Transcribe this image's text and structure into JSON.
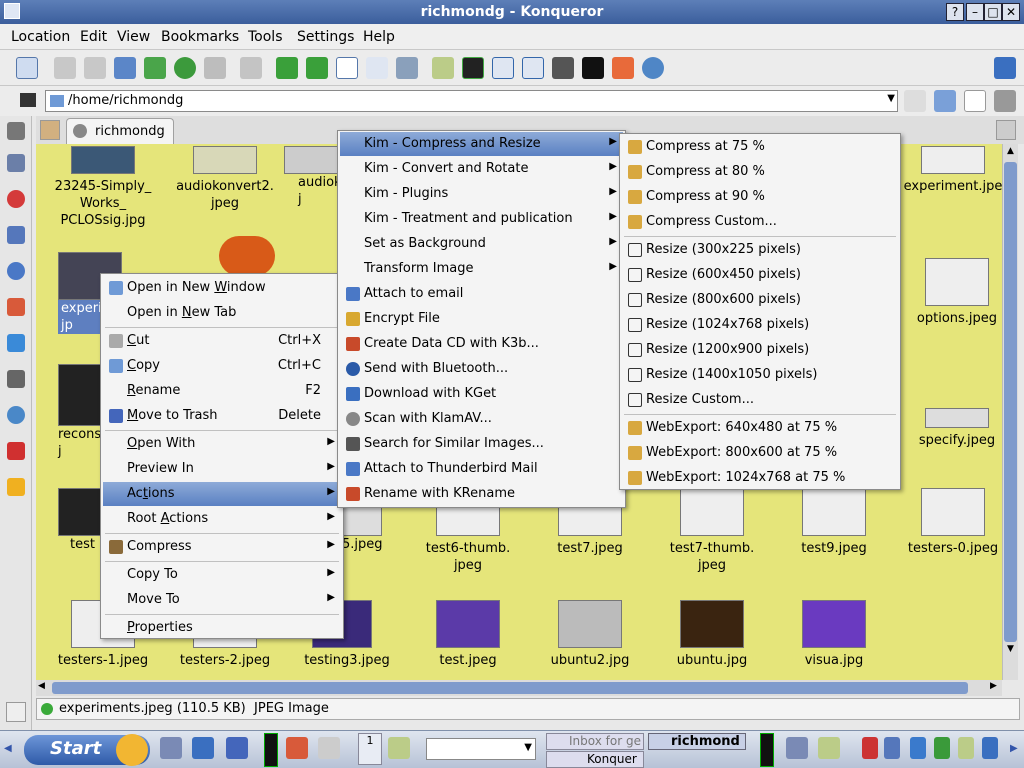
{
  "window": {
    "title": "richmondg - Konqueror",
    "help": "?"
  },
  "menubar": [
    "Location",
    "Edit",
    "View",
    "Bookmarks",
    "Tools",
    "Settings",
    "Help"
  ],
  "location": {
    "path": "/home/richmondg"
  },
  "tab": {
    "label": "richmondg"
  },
  "files": [
    {
      "name": "23245-Simply_\nWorks_\nPCLOSsig.jpg"
    },
    {
      "name": "audiokonvert2.\njpeg"
    },
    {
      "name": "audiok\nj"
    },
    {
      "name": "experiment.jpe"
    },
    {
      "name": "experi\njp"
    },
    {
      "name": "options.jpeg"
    },
    {
      "name": "recons\nj"
    },
    {
      "name": "specify.jpeg"
    },
    {
      "name": "test"
    },
    {
      "name": "5.jpeg"
    },
    {
      "name": "test6-thumb.\njpeg"
    },
    {
      "name": "test7.jpeg"
    },
    {
      "name": "test7-thumb.\njpeg"
    },
    {
      "name": "test9.jpeg"
    },
    {
      "name": "testers-0.jpeg"
    },
    {
      "name": "testers-1.jpeg"
    },
    {
      "name": "testers-2.jpeg"
    },
    {
      "name": "testing3.jpeg"
    },
    {
      "name": "test.jpeg"
    },
    {
      "name": "ubuntu2.jpg"
    },
    {
      "name": "ubuntu.jpg"
    },
    {
      "name": "visua.jpg"
    }
  ],
  "context_menu": {
    "open_new_window": {
      "pre": "Open in New ",
      "u": "W",
      "post": "indow"
    },
    "open_new_tab": {
      "pre": "Open in ",
      "u": "N",
      "post": "ew Tab"
    },
    "cut": {
      "u": "C",
      "post": "ut",
      "shortcut": "Ctrl+X"
    },
    "copy": {
      "u": "C",
      "post": "opy",
      "shortcut": "Ctrl+C"
    },
    "rename": {
      "u": "R",
      "post": "ename",
      "shortcut": "F2"
    },
    "trash": {
      "u": "M",
      "post": "ove to Trash",
      "shortcut": "Delete"
    },
    "open_with": {
      "u": "O",
      "post": "pen With"
    },
    "preview_in": "Preview In",
    "actions": {
      "pre": "Ac",
      "u": "t",
      "post": "ions"
    },
    "root_actions": {
      "pre": "Root ",
      "u": "A",
      "post": "ctions"
    },
    "compress": "Compress",
    "copy_to": "Copy To",
    "move_to": "Move To",
    "properties": {
      "u": "P",
      "post": "roperties"
    }
  },
  "actions_menu": [
    "Kim - Compress and Resize",
    "Kim - Convert and Rotate",
    "Kim - Plugins",
    "Kim - Treatment and publication",
    "Set as Background",
    "Transform Image",
    "Attach to email",
    "Encrypt File",
    "Create Data CD with K3b...",
    "Send with Bluetooth...",
    "Download with KGet",
    "Scan with KlamAV...",
    "Search for Similar Images...",
    "Attach to Thunderbird Mail",
    "Rename with KRename"
  ],
  "kim_menu": [
    "Compress at 75 %",
    "Compress at 80 %",
    "Compress at 90 %",
    "Compress Custom...",
    "Resize (300x225 pixels)",
    "Resize (600x450 pixels)",
    "Resize (800x600 pixels)",
    "Resize (1024x768 pixels)",
    "Resize (1200x900 pixels)",
    "Resize (1400x1050 pixels)",
    "Resize Custom...",
    "WebExport: 640x480 at 75 %",
    "WebExport: 800x600 at 75 %",
    "WebExport: 1024x768 at 75 %"
  ],
  "status": {
    "text": "experiments.jpeg (110.5 KB)  JPEG Image"
  },
  "taskbar": {
    "start": "Start",
    "desktop_num": "1",
    "task1": "Inbox for ge",
    "task2": "richmond",
    "task3": "Konquer"
  }
}
